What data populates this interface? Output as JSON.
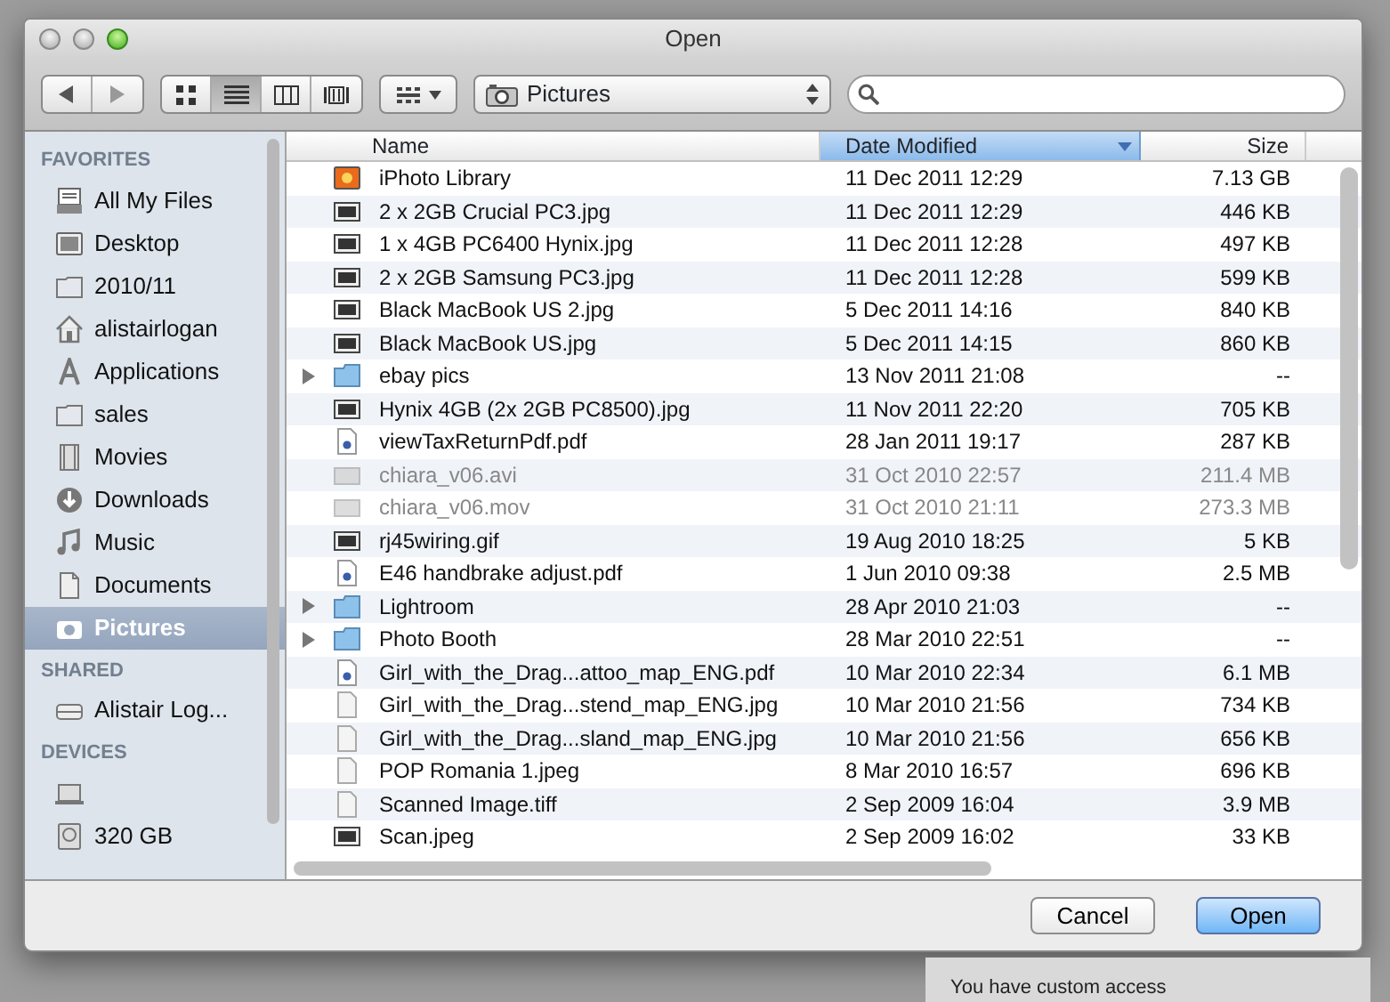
{
  "window": {
    "title": "Open"
  },
  "toolbar": {
    "view_buttons": [
      {
        "kind": "icons",
        "selected": false
      },
      {
        "kind": "list",
        "selected": true
      },
      {
        "kind": "columns",
        "selected": false
      },
      {
        "kind": "coverflow",
        "selected": false
      }
    ],
    "location": "Pictures"
  },
  "sidebar": {
    "sections": [
      {
        "title": "FAVORITES",
        "items": [
          {
            "label": "All My Files",
            "kind": "files",
            "selected": false
          },
          {
            "label": "Desktop",
            "kind": "desktop",
            "selected": false
          },
          {
            "label": "2010/11",
            "kind": "folder",
            "selected": false
          },
          {
            "label": "alistairlogan",
            "kind": "home",
            "selected": false
          },
          {
            "label": "Applications",
            "kind": "applications",
            "selected": false
          },
          {
            "label": "sales",
            "kind": "folder",
            "selected": false
          },
          {
            "label": "Movies",
            "kind": "movies",
            "selected": false
          },
          {
            "label": "Downloads",
            "kind": "downloads",
            "selected": false
          },
          {
            "label": "Music",
            "kind": "music",
            "selected": false
          },
          {
            "label": "Documents",
            "kind": "documents",
            "selected": false
          },
          {
            "label": "Pictures",
            "kind": "pictures",
            "selected": true
          }
        ]
      },
      {
        "title": "SHARED",
        "items": [
          {
            "label": "Alistair Log...",
            "kind": "network",
            "selected": false
          }
        ]
      },
      {
        "title": "DEVICES",
        "items": [
          {
            "kind": "laptop",
            "selected": false
          },
          {
            "label": "320 GB",
            "kind": "disk",
            "selected": false
          }
        ]
      }
    ]
  },
  "table": {
    "columns": [
      {
        "label": "Name",
        "sorted": false
      },
      {
        "label": "Date Modified",
        "sorted": true
      },
      {
        "label": "Size",
        "sorted": false
      }
    ],
    "rows": [
      {
        "name": "iPhoto Library",
        "date": "11 Dec 2011 12:29",
        "size": "7.13 GB",
        "kind": "library",
        "disabled": false
      },
      {
        "name": "2 x 2GB Crucial PC3.jpg",
        "date": "11 Dec 2011 12:29",
        "size": "446 KB",
        "kind": "image",
        "disabled": false
      },
      {
        "name": "1 x 4GB PC6400 Hynix.jpg",
        "date": "11 Dec 2011 12:28",
        "size": "497 KB",
        "kind": "image",
        "disabled": false
      },
      {
        "name": "2 x 2GB Samsung PC3.jpg",
        "date": "11 Dec 2011 12:28",
        "size": "599 KB",
        "kind": "image",
        "disabled": false
      },
      {
        "name": "Black MacBook US 2.jpg",
        "date": "5 Dec 2011 14:16",
        "size": "840 KB",
        "kind": "image",
        "disabled": false
      },
      {
        "name": "Black MacBook US.jpg",
        "date": "5 Dec 2011 14:15",
        "size": "860 KB",
        "kind": "image",
        "disabled": false
      },
      {
        "name": "ebay pics",
        "date": "13 Nov 2011 21:08",
        "size": "--",
        "kind": "folder",
        "disabled": false
      },
      {
        "name": "Hynix 4GB (2x 2GB PC8500).jpg",
        "date": "11 Nov 2011 22:20",
        "size": "705 KB",
        "kind": "image",
        "disabled": false
      },
      {
        "name": "viewTaxReturnPdf.pdf",
        "date": "28 Jan 2011 19:17",
        "size": "287 KB",
        "kind": "pdf",
        "disabled": false
      },
      {
        "name": "chiara_v06.avi",
        "date": "31 Oct 2010 22:57",
        "size": "211.4 MB",
        "kind": "video",
        "disabled": true
      },
      {
        "name": "chiara_v06.mov",
        "date": "31 Oct 2010 21:11",
        "size": "273.3 MB",
        "kind": "video",
        "disabled": true
      },
      {
        "name": "rj45wiring.gif",
        "date": "19 Aug 2010 18:25",
        "size": "5 KB",
        "kind": "image",
        "disabled": false
      },
      {
        "name": "E46 handbrake adjust.pdf",
        "date": "1 Jun 2010 09:38",
        "size": "2.5 MB",
        "kind": "pdf",
        "disabled": false
      },
      {
        "name": "Lightroom",
        "date": "28 Apr 2010 21:03",
        "size": "--",
        "kind": "folder",
        "disabled": false
      },
      {
        "name": "Photo Booth",
        "date": "28 Mar 2010 22:51",
        "size": "--",
        "kind": "folder",
        "disabled": false
      },
      {
        "name": "Girl_with_the_Drag...attoo_map_ENG.pdf",
        "date": "10 Mar 2010 22:34",
        "size": "6.1 MB",
        "kind": "pdf",
        "disabled": false
      },
      {
        "name": "Girl_with_the_Drag...stend_map_ENG.jpg",
        "date": "10 Mar 2010 21:56",
        "size": "734 KB",
        "kind": "document",
        "disabled": false
      },
      {
        "name": "Girl_with_the_Drag...sland_map_ENG.jpg",
        "date": "10 Mar 2010 21:56",
        "size": "656 KB",
        "kind": "document",
        "disabled": false
      },
      {
        "name": "POP Romania 1.jpeg",
        "date": "8 Mar 2010 16:57",
        "size": "696 KB",
        "kind": "document",
        "disabled": false
      },
      {
        "name": "Scanned Image.tiff",
        "date": "2 Sep 2009 16:04",
        "size": "3.9 MB",
        "kind": "document",
        "disabled": false
      },
      {
        "name": "Scan.jpeg",
        "date": "2 Sep 2009 16:02",
        "size": "33 KB",
        "kind": "image",
        "disabled": false
      }
    ]
  },
  "buttons": [
    {
      "label": "Cancel",
      "default": false
    },
    {
      "label": "Open",
      "default": true
    }
  ],
  "background": {
    "text": "You have custom access"
  }
}
